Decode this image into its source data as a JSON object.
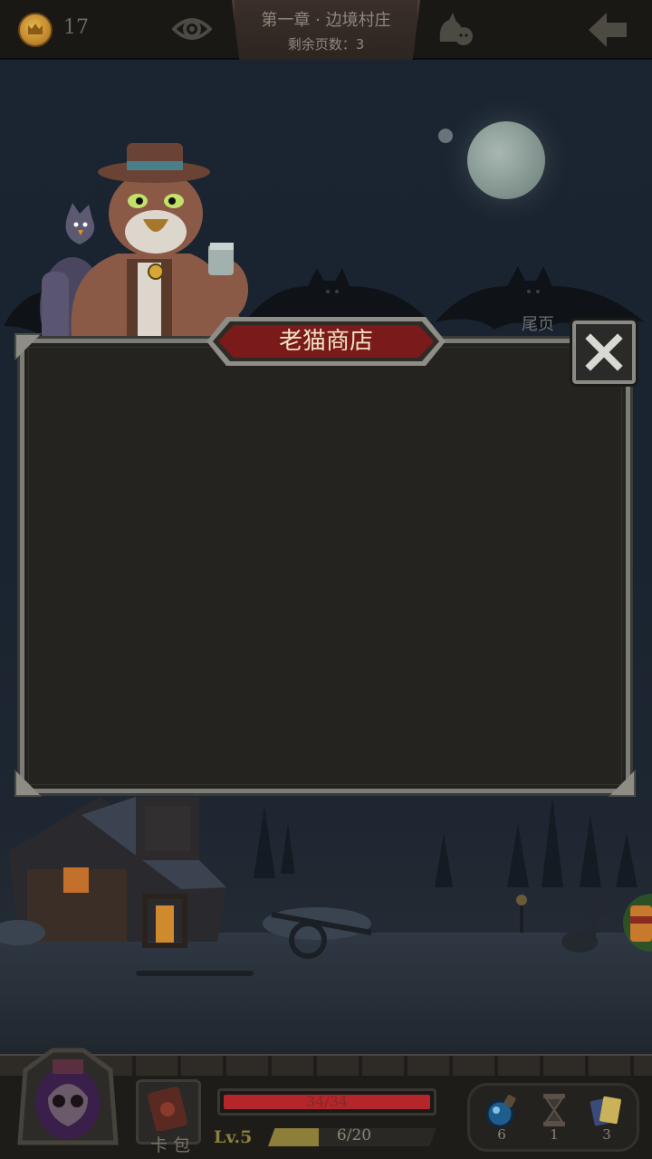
{
  "top_bar": {
    "coin_count": "17",
    "chapter_title": "第一章 · 边境村庄",
    "pages_remaining": "剩余页数：3"
  },
  "scene": {
    "bat_label": "尾页"
  },
  "shop": {
    "title": "老猫商店"
  },
  "bottom_bar": {
    "deck_label": "卡 包",
    "hp_text": "34/34",
    "hp_fraction": 1.0,
    "level_label": "Lv.5",
    "xp_text": "6/20",
    "xp_fraction": 0.3,
    "items": [
      {
        "icon": "potion-icon",
        "count": "6"
      },
      {
        "icon": "hourglass-icon",
        "count": "1"
      },
      {
        "icon": "cards-icon",
        "count": "3"
      }
    ]
  },
  "colors": {
    "hp": "#b5262a",
    "xp": "#8d7f3a",
    "banner": "#7a1a1a"
  }
}
